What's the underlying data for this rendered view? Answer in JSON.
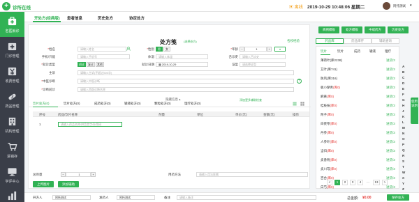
{
  "app": {
    "name": "诊所在线"
  },
  "header": {
    "mode": "离线",
    "datetime": "2019-10-29 10:48:06 星期二",
    "user": "阿托测试"
  },
  "sidebar": {
    "items": [
      {
        "label": "名医就诊",
        "icon": "medkit-icon"
      },
      {
        "label": "门诊管理",
        "icon": "clinic-icon"
      },
      {
        "label": "收费管理",
        "icon": "money-icon"
      },
      {
        "label": "药品管理",
        "icon": "pill-icon"
      },
      {
        "label": "机构管理",
        "icon": "building-icon"
      },
      {
        "label": "进销存",
        "icon": "cart-icon"
      },
      {
        "label": "学评中心",
        "icon": "monitor-icon"
      },
      {
        "label": "统计管理",
        "icon": "chart-icon"
      }
    ]
  },
  "tabs": [
    "开处方(经典版)",
    "患者信息",
    "历史处方",
    "协定处方"
  ],
  "form": {
    "title": "处方笺",
    "title_link": "(选择处方)",
    "top_right_link": "名校经验",
    "labels": {
      "name": "姓名",
      "gender": "性别",
      "age": "年龄",
      "phone": "手机/只能",
      "diagnosis": "体温",
      "pulse": "舌诊史",
      "type": "就诊类型",
      "date": "就诊日期",
      "syndrome": "证型",
      "chief": "主诉",
      "tcm": "中医诊断",
      "wm": "诊断前诊"
    },
    "placeholders": {
      "name": "请输入姓名",
      "phone": "请输入手机号",
      "temp": "请输入体温",
      "pulse": "请输入舌诊史",
      "syndrome": "请选择证型",
      "chief": "请输入主诉(不超过500字)",
      "tcm": "请输入中医诊断",
      "wm": "请输入西医诊断名称"
    },
    "gender_value": "男",
    "gender_option": "女",
    "age_value": "1",
    "type_options": [
      "初诊",
      "复诊",
      "其他"
    ],
    "date_value": "2019-10-29",
    "collapse_link": "隐藏信息",
    "add_link": "添加更多辅助检查"
  },
  "rx_tabs": [
    "饮片处方(0)",
    "饮片处方(0)",
    "成药处方(0)",
    "输液处方(0)",
    "颗粒处方(0)",
    "理疗处方(0)"
  ],
  "table": {
    "headers": [
      "序号",
      "药品/饮片名称",
      "剂量",
      "单位",
      "单价(元)",
      "金额(元)",
      "操作"
    ],
    "row_no": "1",
    "placeholder": "请输入药品名称/拼音首字母/简码"
  },
  "bottom_form": {
    "total_label": "总剂量",
    "total_value": "1",
    "method_label": "用药方法",
    "method_placeholder": "请输入用法医嘱",
    "left_btn": "上传图片",
    "right_btn": "添加辅助"
  },
  "footer": {
    "doctor_label": "开方人",
    "doctor_value": "阿托测试",
    "dispenser_label": "发药人",
    "dispenser_value": "阿托测试",
    "note_label": "备注",
    "note_placeholder": "请输入备注",
    "total_label": "总金额:",
    "total_value": "¥0.00",
    "save_btn": "保存处方"
  },
  "right": {
    "buttons": [
      "病例模板",
      "处方模板",
      "中成药方",
      "历史处方"
    ],
    "search": [
      "药品库",
      "药品库存",
      "辅助查询"
    ],
    "tabs": [
      "饮片",
      "饮片",
      "成药",
      "输液",
      "理疗"
    ],
    "herbs": [
      {
        "name": "薄荷叶",
        "stock": "(库2238)",
        "price": "进货/3"
      },
      {
        "name": "艾叶",
        "stock": "(库741)",
        "price": "进货/3"
      },
      {
        "name": "防风",
        "stock": "(库316)",
        "price": "进货/3"
      },
      {
        "name": "板小蓼青",
        "stock": "(库0)",
        "price": "进货/3"
      },
      {
        "name": "麻黄",
        "stock": "(库0)",
        "price": "进货/3"
      },
      {
        "name": "桂枝枝",
        "stock": "(库0)",
        "price": "进货/3"
      },
      {
        "name": "附子",
        "stock": "(库0)",
        "price": "进货/3"
      },
      {
        "name": "白茯苓",
        "stock": "(库0)",
        "price": "进货/3"
      },
      {
        "name": "丹参",
        "stock": "(库0)",
        "price": "进货/3"
      },
      {
        "name": "人参叶",
        "stock": "(库0)",
        "price": "进货/3"
      },
      {
        "name": "当归",
        "stock": "(库0)",
        "price": "进货/3"
      },
      {
        "name": "炙香附",
        "stock": "(库0)",
        "price": "进货/3"
      },
      {
        "name": "炙川芎",
        "stock": "(库0)",
        "price": "进货/3"
      },
      {
        "name": "百合",
        "stock": "(库0)",
        "price": "进货/3"
      },
      {
        "name": "白芍",
        "stock": "(库0)",
        "price": "进货/3"
      }
    ],
    "letters": [
      "A",
      "B",
      "C",
      "D",
      "E",
      "F",
      "G",
      "H",
      "J",
      "K",
      "L",
      "M",
      "N",
      "O",
      "P",
      "Q",
      "R",
      "S",
      "T",
      "W",
      "X",
      "Y",
      "Z"
    ],
    "pages": [
      "1",
      "2",
      "3",
      "4",
      "...",
      "13",
      ">"
    ],
    "vtab": "使用说明"
  },
  "colors": {
    "accent": "#31b254",
    "sidebar": "#3a3e48",
    "danger": "#e53935"
  }
}
